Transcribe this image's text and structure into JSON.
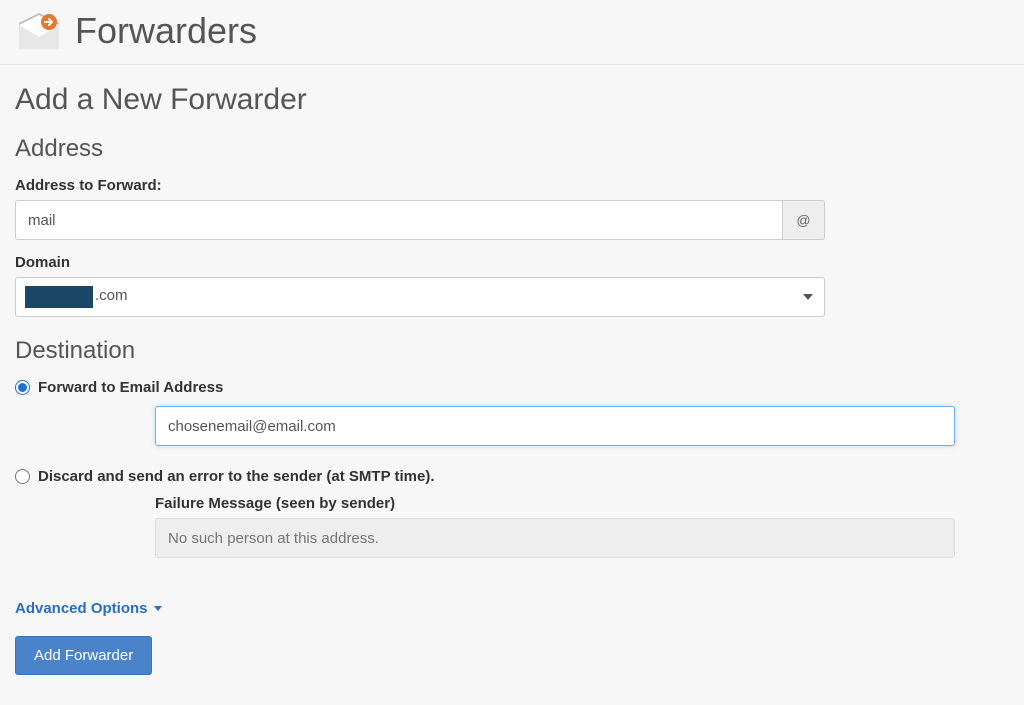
{
  "header": {
    "title": "Forwarders"
  },
  "subtitle": "Add a New Forwarder",
  "address_section": {
    "title": "Address",
    "address_label": "Address to Forward:",
    "address_value": "mail",
    "at_symbol": "@",
    "domain_label": "Domain",
    "domain_value_suffix": ".com"
  },
  "destination_section": {
    "title": "Destination",
    "option_forward": {
      "label": "Forward to Email Address",
      "value": "chosenemail@email.com",
      "selected": true
    },
    "option_discard": {
      "label": "Discard and send an error to the sender (at SMTP time).",
      "failure_label": "Failure Message (seen by sender)",
      "failure_placeholder": "No such person at this address.",
      "selected": false
    }
  },
  "advanced_options_label": "Advanced Options",
  "submit_label": "Add Forwarder"
}
